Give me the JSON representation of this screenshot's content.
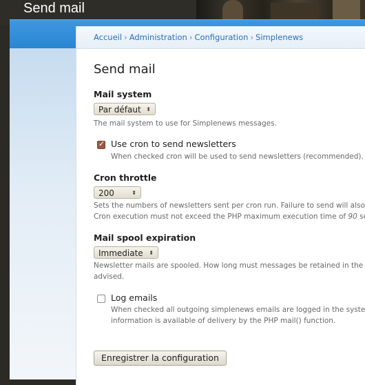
{
  "site_header": {
    "title": "Send mail"
  },
  "breadcrumb": {
    "items": [
      "Accueil",
      "Administration",
      "Configuration",
      "Simplenews"
    ],
    "separator": "›"
  },
  "page": {
    "title": "Send mail"
  },
  "form": {
    "mail_system": {
      "label": "Mail system",
      "value": "Par défaut",
      "description": "The mail system to use for Simplenews messages."
    },
    "use_cron": {
      "checked": true,
      "label": "Use cron to send newsletters",
      "description": "When checked cron will be used to send newsletters (recommended). Te"
    },
    "cron_throttle": {
      "label": "Cron throttle",
      "value": "200",
      "description_line1": "Sets the numbers of newsletters sent per cron run. Failure to send will also be",
      "description_line2_prefix": "Cron execution must not exceed the PHP maximum execution time of ",
      "description_line2_em": "90",
      "description_line2_suffix": " sec"
    },
    "spool_expiration": {
      "label": "Mail spool expiration",
      "value": "Immediate",
      "description_line1": "Newsletter mails are spooled. How long must messages be retained in the spo",
      "description_line2": "advised."
    },
    "log_emails": {
      "checked": false,
      "label": "Log emails",
      "description_line1": "When checked all outgoing simplenews emails are logged in the system",
      "description_line2": "information is available of delivery by the PHP mail() function."
    },
    "submit_label": "Enregistrer la configuration"
  },
  "icons": {
    "select_arrow": "updown-arrow-icon",
    "check": "checkmark-icon"
  },
  "colors": {
    "overlay_blue": "#2a85d2",
    "link": "#2a6fb8",
    "checkbox_checked": "#9a5b3e"
  }
}
